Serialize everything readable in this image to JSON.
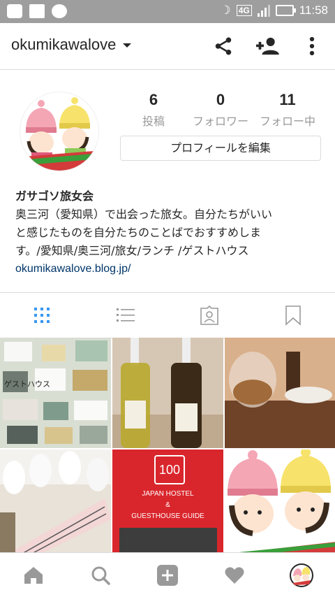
{
  "status_bar": {
    "lte": "4G",
    "time": "11:58",
    "icons": [
      "line-icon",
      "gallery-icon",
      "message-icon",
      "moon-icon",
      "signal-icon",
      "battery-icon"
    ]
  },
  "header": {
    "username": "okumikawalove",
    "icons": [
      "share-icon",
      "add-person-icon",
      "more-icon"
    ]
  },
  "profile": {
    "stats": [
      {
        "number": "6",
        "label": "投稿"
      },
      {
        "number": "0",
        "label": "フォロワー"
      },
      {
        "number": "11",
        "label": "フォロー中"
      }
    ],
    "edit_button": "プロフィールを編集",
    "bio_name": "ガサゴソ旅女会",
    "bio_line1": "奥三河（愛知県）で出会った旅女。自分たちがいい",
    "bio_line2": "と感じたものを自分たちのことばでおすすめしま",
    "bio_line3": "す。/愛知県/奥三河/旅女/ランチ /ゲストハウス",
    "bio_link": "okumikawalove.blog.jp/"
  },
  "tabs": [
    {
      "name": "grid-view",
      "icon": "grid-icon",
      "active": true
    },
    {
      "name": "list-view",
      "icon": "list-icon",
      "active": false
    },
    {
      "name": "tagged",
      "icon": "tagged-person-icon",
      "active": false
    },
    {
      "name": "saved",
      "icon": "bookmark-icon",
      "active": false
    }
  ],
  "posts": [
    {
      "description": "map-collage"
    },
    {
      "description": "oil-bottles"
    },
    {
      "description": "tea-pot"
    },
    {
      "description": "cups-and-note"
    },
    {
      "description": "guesthouse-guide-book",
      "book_number": "100",
      "book_title1": "JAPAN HOSTEL",
      "book_amp": "&",
      "book_title2": "GUESTHOUSE GUIDE"
    },
    {
      "description": "illustration-girls"
    }
  ],
  "bottom_nav": [
    "home-icon",
    "search-icon",
    "add-icon",
    "heart-icon",
    "profile-avatar-icon"
  ],
  "colors": {
    "accent": "#3897f0",
    "link": "#003569",
    "statusbar": "#9e9e9e",
    "nav_icon": "#999999"
  }
}
